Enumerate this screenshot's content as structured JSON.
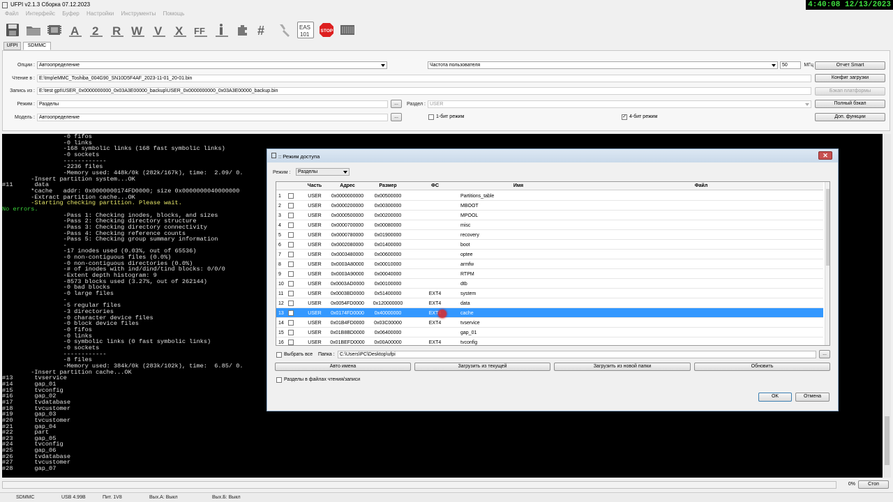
{
  "window": {
    "title": "UFPI v2.1.3 Сборка 07.12.2023",
    "clock": "4:40:08  12/13/2023"
  },
  "menu": [
    "Файл",
    "Интерфейс",
    "Буфер",
    "Настройки",
    "Инструменты",
    "Помощь"
  ],
  "toolbar": {
    "eas_label": "EAS 101",
    "stop_label": "STOP"
  },
  "tabs": [
    "UFPI",
    "SDMMC"
  ],
  "settings": {
    "options_label": "Опции :",
    "options_value": "Автоопределение",
    "freq_value": "Частота пользователя",
    "freq_num": "50",
    "freq_unit": "МГц",
    "read_label": "Чтение в :",
    "read_path": "E:\\tmp\\eMMC_Toshiba_004G90_SN10D5F4AF_2023-11-01_20-01.bin",
    "write_label": "Запись из :",
    "write_path": "E:\\test gpt\\USER_0x0000000000_0x03A3E00000_backup\\USER_0x0000000000_0x03A3E00000_backup.bin",
    "mode_label": "Режим :",
    "mode_value": "Разделы",
    "partition_label": "Раздел :",
    "partition_value": "USER",
    "model_label": "Модель :",
    "model_value": "Автоопределение",
    "bit1_label": "1-бит режим",
    "bit4_label": "4-бит режим",
    "btn_smart": "Отчет Smart",
    "btn_config": "Конфиг загрузки",
    "btn_platform": "Бэкап платформы",
    "btn_full": "Полный бэкап",
    "btn_extra": "Доп. функции",
    "browse": "..."
  },
  "console_lines": [
    {
      "t": "                 -0 fifos",
      "c": ""
    },
    {
      "t": "                 -0 links",
      "c": ""
    },
    {
      "t": "                 -168 symbolic links (168 fast symbolic links)",
      "c": ""
    },
    {
      "t": "                 -0 sockets",
      "c": ""
    },
    {
      "t": "                 ------------",
      "c": ""
    },
    {
      "t": "                 -2236 files",
      "c": ""
    },
    {
      "t": "                 -Memory used: 448k/0k (282k/167k), time:  2.09/ 0.",
      "c": ""
    },
    {
      "t": "        -Insert partition system...OK",
      "c": ""
    },
    {
      "t": "#11      data",
      "c": ""
    },
    {
      "t": "        *cache   addr: 0x0000000174FD0000; size 0x0000000040000000",
      "c": ""
    },
    {
      "t": "        -Extract partition cache...OK",
      "c": ""
    },
    {
      "t": "        -Starting checking partition. Please wait.",
      "c": "y"
    },
    {
      "t": "No errors.",
      "c": "g"
    },
    {
      "t": "                 -Pass 1: Checking inodes, blocks, and sizes",
      "c": ""
    },
    {
      "t": "                 -Pass 2: Checking directory structure",
      "c": ""
    },
    {
      "t": "                 -Pass 3: Checking directory connectivity",
      "c": ""
    },
    {
      "t": "                 -Pass 4: Checking reference counts",
      "c": ""
    },
    {
      "t": "                 -Pass 5: Checking group summary information",
      "c": ""
    },
    {
      "t": "                 -",
      "c": ""
    },
    {
      "t": "                 -17 inodes used (0.03%, out of 65536)",
      "c": ""
    },
    {
      "t": "                 -0 non-contiguous files (0.0%)",
      "c": ""
    },
    {
      "t": "                 -0 non-contiguous directories (0.0%)",
      "c": ""
    },
    {
      "t": "                 -# of inodes with ind/dind/tind blocks: 0/0/0",
      "c": ""
    },
    {
      "t": "                 -Extent depth histogram: 9",
      "c": ""
    },
    {
      "t": "                 -8573 blocks used (3.27%, out of 262144)",
      "c": ""
    },
    {
      "t": "                 -0 bad blocks",
      "c": ""
    },
    {
      "t": "                 -0 large files",
      "c": ""
    },
    {
      "t": "                 -",
      "c": ""
    },
    {
      "t": "                 -5 regular files",
      "c": ""
    },
    {
      "t": "                 -3 directories",
      "c": ""
    },
    {
      "t": "                 -0 character device files",
      "c": ""
    },
    {
      "t": "                 -0 block device files",
      "c": ""
    },
    {
      "t": "                 -0 fifos",
      "c": ""
    },
    {
      "t": "                 -0 links",
      "c": ""
    },
    {
      "t": "                 -0 symbolic links (0 fast symbolic links)",
      "c": ""
    },
    {
      "t": "                 -0 sockets",
      "c": ""
    },
    {
      "t": "                 ------------",
      "c": ""
    },
    {
      "t": "                 -8 files",
      "c": ""
    },
    {
      "t": "                 -Memory used: 384k/0k (283k/102k), time:  6.85/ 0.",
      "c": ""
    },
    {
      "t": "        -Insert partition cache...OK",
      "c": ""
    },
    {
      "t": "#13      tvservice",
      "c": ""
    },
    {
      "t": "#14      gap_01",
      "c": ""
    },
    {
      "t": "#15      tvconfig",
      "c": ""
    },
    {
      "t": "#16      gap_02",
      "c": ""
    },
    {
      "t": "#17      tvdatabase",
      "c": ""
    },
    {
      "t": "#18      tvcustomer",
      "c": ""
    },
    {
      "t": "#19      gap_03",
      "c": ""
    },
    {
      "t": "#20      tvcustomer",
      "c": ""
    },
    {
      "t": "#21      gap_04",
      "c": ""
    },
    {
      "t": "#22      part",
      "c": ""
    },
    {
      "t": "#23      gap_05",
      "c": ""
    },
    {
      "t": "#24      tvconfig",
      "c": ""
    },
    {
      "t": "#25      gap_06",
      "c": ""
    },
    {
      "t": "#26      tvdatabase",
      "c": ""
    },
    {
      "t": "#27      tvcustomer",
      "c": ""
    },
    {
      "t": "#28      gap_07",
      "c": ""
    }
  ],
  "progress": {
    "percent": "0%",
    "stop_label": "Стоп"
  },
  "status": {
    "mode": "SDMMC",
    "usb": "USB 4.99В",
    "power": "Пит. 1V8",
    "outA": "Вых.А: Выкл",
    "outB": "Вых.Б: Выкл"
  },
  "dialog": {
    "title": ":: Режим доступа",
    "close": "✕",
    "mode_label": "Режим :",
    "mode_value": "Разделы",
    "columns": [
      "Часть",
      "Адрес",
      "Размер",
      "ФС",
      "Имя",
      "Файл"
    ],
    "rows": [
      {
        "n": "1",
        "checked": false,
        "part": "USER",
        "addr": "0x0000000000",
        "size": "0x00500000",
        "fs": "",
        "name": "Partitions_table"
      },
      {
        "n": "2",
        "checked": false,
        "part": "USER",
        "addr": "0x0000200000",
        "size": "0x00300000",
        "fs": "",
        "name": "MBOOT"
      },
      {
        "n": "3",
        "checked": false,
        "part": "USER",
        "addr": "0x0000500000",
        "size": "0x00200000",
        "fs": "",
        "name": "MPOOL"
      },
      {
        "n": "4",
        "checked": false,
        "part": "USER",
        "addr": "0x0000700000",
        "size": "0x00080000",
        "fs": "",
        "name": "misc"
      },
      {
        "n": "5",
        "checked": false,
        "part": "USER",
        "addr": "0x0000780000",
        "size": "0x01900000",
        "fs": "",
        "name": "recovery"
      },
      {
        "n": "6",
        "checked": false,
        "part": "USER",
        "addr": "0x0002080000",
        "size": "0x01400000",
        "fs": "",
        "name": "boot"
      },
      {
        "n": "7",
        "checked": false,
        "part": "USER",
        "addr": "0x0003480000",
        "size": "0x00600000",
        "fs": "",
        "name": "optee"
      },
      {
        "n": "8",
        "checked": false,
        "part": "USER",
        "addr": "0x0003A80000",
        "size": "0x00010000",
        "fs": "",
        "name": "armfw"
      },
      {
        "n": "9",
        "checked": false,
        "part": "USER",
        "addr": "0x0003A90000",
        "size": "0x00040000",
        "fs": "",
        "name": "RTPM"
      },
      {
        "n": "10",
        "checked": false,
        "part": "USER",
        "addr": "0x0003AD0000",
        "size": "0x00100000",
        "fs": "",
        "name": "dtb"
      },
      {
        "n": "11",
        "checked": false,
        "part": "USER",
        "addr": "0x0003BD0000",
        "size": "0x51400000",
        "fs": "EXT4",
        "name": "system"
      },
      {
        "n": "12",
        "checked": false,
        "part": "USER",
        "addr": "0x0054FD0000",
        "size": "0x120000000",
        "fs": "EXT4",
        "name": "data"
      },
      {
        "n": "13",
        "checked": true,
        "part": "USER",
        "addr": "0x0174FD0000",
        "size": "0x40000000",
        "fs": "EXT4",
        "name": "cache"
      },
      {
        "n": "14",
        "checked": false,
        "part": "USER",
        "addr": "0x01B4FD0000",
        "size": "0x03C00000",
        "fs": "EXT4",
        "name": "tvservice"
      },
      {
        "n": "15",
        "checked": false,
        "part": "USER",
        "addr": "0x01B8BD0000",
        "size": "0x06400000",
        "fs": "",
        "name": "gap_01"
      },
      {
        "n": "16",
        "checked": false,
        "part": "USER",
        "addr": "0x01BEFD0000",
        "size": "0x00A00000",
        "fs": "EXT4",
        "name": "tvconfig"
      }
    ],
    "selected_row": "13",
    "select_all": "Выбрать все",
    "folder_label": "Папка :",
    "folder_value": "C:\\Users\\PC\\Desktop\\ufpi",
    "browse": "...",
    "btn_auto": "Авто имена",
    "btn_load_current": "Загрузить из текущей",
    "btn_load_new": "Загрузить из новой папки",
    "btn_refresh": "Обновить",
    "partitions_in_files": "Разделы в файлах чтения/записи",
    "ok": "OK",
    "cancel": "Отмена"
  },
  "colors": {
    "selection": "#3398ff",
    "console_bg": "#000000",
    "console_green": "#3cd43c",
    "console_yellow": "#e8e86a",
    "stop_red": "#dd1f1f"
  }
}
